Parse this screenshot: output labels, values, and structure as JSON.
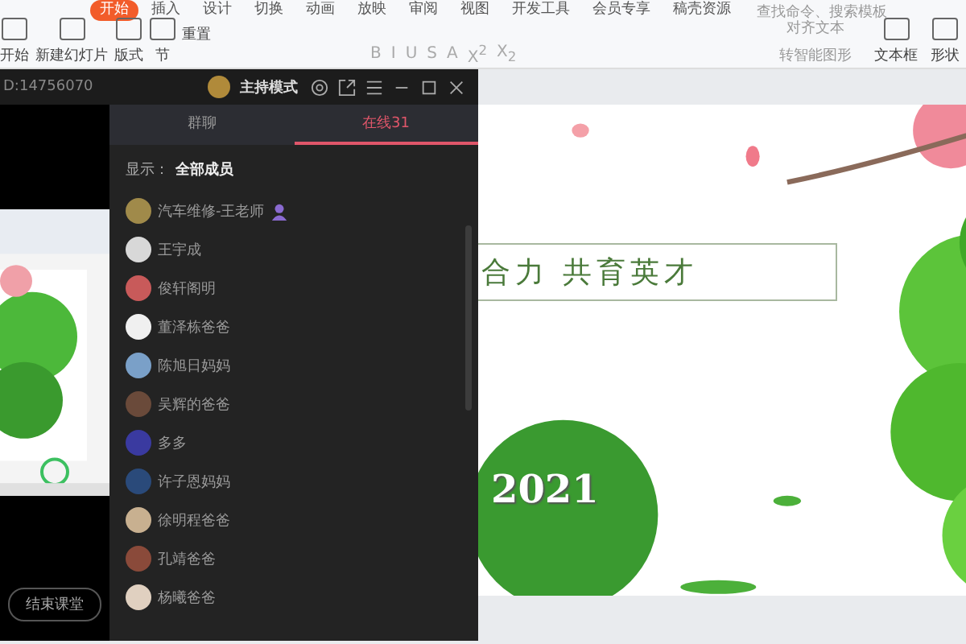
{
  "ribbon": {
    "tabs": [
      {
        "label": "开始",
        "selected": true
      },
      {
        "label": "插入",
        "selected": false
      },
      {
        "label": "设计",
        "selected": false
      },
      {
        "label": "切换",
        "selected": false
      },
      {
        "label": "动画",
        "selected": false
      },
      {
        "label": "放映",
        "selected": false
      },
      {
        "label": "审阅",
        "selected": false
      },
      {
        "label": "视图",
        "selected": false
      },
      {
        "label": "开发工具",
        "selected": false
      },
      {
        "label": "会员专享",
        "selected": false
      },
      {
        "label": "稿壳资源",
        "selected": false
      }
    ],
    "search": {
      "placeholder": "查找命令、搜索模板"
    },
    "left_tools": [
      {
        "label": "开始"
      },
      {
        "label": "新建幻灯片"
      },
      {
        "label": "版式"
      },
      {
        "label": "节"
      }
    ],
    "reset": "重置",
    "format_buttons": [
      "B",
      "I",
      "U",
      "S",
      "A",
      "X$^{2}$",
      "X$_{2}$"
    ],
    "text_tools": [
      "对齐文本",
      "转智能图形"
    ],
    "right_tools": [
      {
        "label": "文本框"
      },
      {
        "label": "形状"
      }
    ]
  },
  "slide": {
    "title": "合力 共育英才",
    "year": "2021"
  },
  "classroom": {
    "room_id": "D:14756070",
    "mode": "主持模式",
    "tabs": [
      {
        "label": "群聊",
        "selected": false
      },
      {
        "label": "在线31",
        "selected": true
      }
    ],
    "filter_label": "显示：",
    "filter_value": "全部成员",
    "members": [
      {
        "name": "汽车维修-王老师",
        "host": true
      },
      {
        "name": "王宇成",
        "host": false
      },
      {
        "name": "俊轩阁明",
        "host": false
      },
      {
        "name": "董泽栋爸爸",
        "host": false
      },
      {
        "name": "陈旭日妈妈",
        "host": false
      },
      {
        "name": "吴辉的爸爸",
        "host": false
      },
      {
        "name": "多多",
        "host": false
      },
      {
        "name": "许子恩妈妈",
        "host": false
      },
      {
        "name": "徐明程爸爸",
        "host": false
      },
      {
        "name": "孔靖爸爸",
        "host": false
      },
      {
        "name": "杨曦爸爸",
        "host": false
      }
    ],
    "end_button": "结束课堂"
  }
}
